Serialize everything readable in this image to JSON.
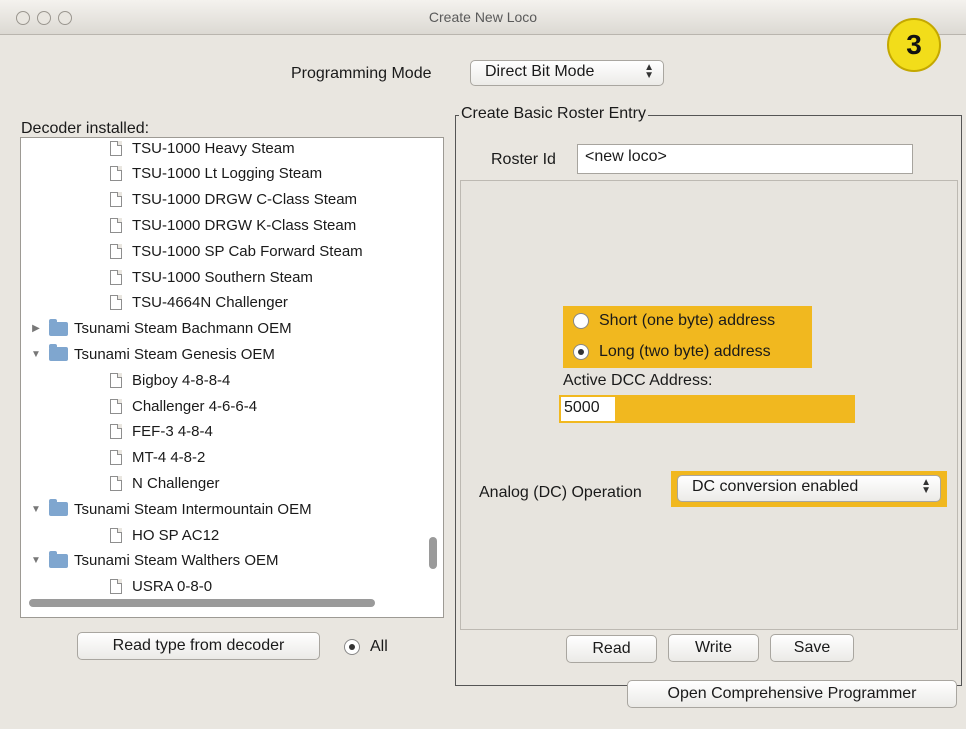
{
  "window": {
    "title": "Create New Loco",
    "step_badge": "3"
  },
  "programming_mode": {
    "label": "Programming Mode",
    "value": "Direct Bit Mode"
  },
  "decoder": {
    "label": "Decoder installed:",
    "tree": [
      {
        "kind": "leaf",
        "text": "TSU-1000 Heavy Steam"
      },
      {
        "kind": "leaf",
        "text": "TSU-1000 Lt Logging Steam"
      },
      {
        "kind": "leaf",
        "text": "TSU-1000 DRGW C-Class Steam"
      },
      {
        "kind": "leaf",
        "text": "TSU-1000 DRGW K-Class Steam"
      },
      {
        "kind": "leaf",
        "text": "TSU-1000 SP Cab Forward Steam"
      },
      {
        "kind": "leaf",
        "text": "TSU-1000 Southern Steam"
      },
      {
        "kind": "leaf",
        "text": "TSU-4664N Challenger"
      },
      {
        "kind": "folder",
        "expanded": false,
        "text": "Tsunami Steam Bachmann OEM"
      },
      {
        "kind": "folder",
        "expanded": true,
        "text": "Tsunami Steam Genesis OEM"
      },
      {
        "kind": "leaf",
        "text": "Bigboy 4-8-8-4"
      },
      {
        "kind": "leaf",
        "text": "Challenger 4-6-6-4"
      },
      {
        "kind": "leaf",
        "text": "FEF-3 4-8-4"
      },
      {
        "kind": "leaf",
        "text": "MT-4 4-8-2"
      },
      {
        "kind": "leaf",
        "text": "N Challenger"
      },
      {
        "kind": "folder",
        "expanded": true,
        "text": "Tsunami Steam Intermountain OEM"
      },
      {
        "kind": "leaf",
        "text": "HO SP AC12"
      },
      {
        "kind": "folder",
        "expanded": true,
        "text": "Tsunami Steam Walthers OEM"
      },
      {
        "kind": "leaf",
        "text": "USRA 0-8-0"
      }
    ],
    "read_type_button": "Read type from decoder",
    "all_radio_label": "All"
  },
  "roster": {
    "group_title": "Create Basic Roster Entry",
    "roster_id_label": "Roster Id",
    "roster_id_value": "<new loco>",
    "short_address_label": "Short (one byte) address",
    "long_address_label": "Long (two byte) address",
    "selected_address_type": "long",
    "active_dcc_label": "Active DCC Address:",
    "active_dcc_value": "5000",
    "analog_label": "Analog (DC) Operation",
    "analog_value": "DC conversion enabled",
    "read_button": "Read",
    "write_button": "Write",
    "save_button": "Save"
  },
  "open_programmer_button": "Open Comprehensive Programmer",
  "colors": {
    "highlight": "#f1b81f",
    "badge": "#f2dd1a",
    "folder": "#7fa6cf"
  }
}
